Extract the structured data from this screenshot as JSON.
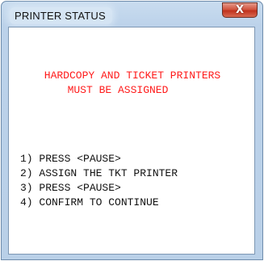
{
  "window": {
    "title": "PRINTER STATUS",
    "close_glyph": "X"
  },
  "message": {
    "line1": "HARDCOPY AND TICKET PRINTERS",
    "line2": "MUST BE ASSIGNED",
    "color": "#ff1a1a"
  },
  "steps": [
    "1) PRESS <PAUSE>",
    "2) ASSIGN THE TKT PRINTER",
    "3) PRESS <PAUSE>",
    "4) CONFIRM TO CONTINUE"
  ],
  "icons": {
    "close": "close-icon"
  }
}
